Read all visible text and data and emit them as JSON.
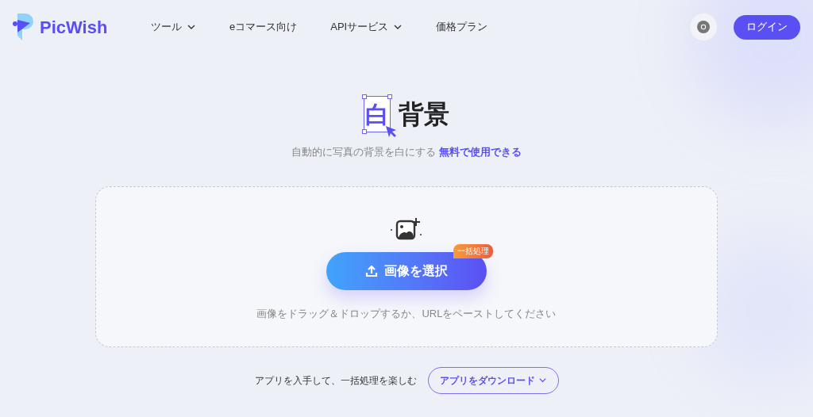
{
  "header": {
    "logo": "PicWish",
    "nav": [
      {
        "label": "ツール",
        "dropdown": true
      },
      {
        "label": "eコマース向け",
        "dropdown": false
      },
      {
        "label": "APIサービス",
        "dropdown": true
      },
      {
        "label": "価格プラン",
        "dropdown": false
      }
    ],
    "login": "ログイン"
  },
  "hero": {
    "title_highlight": "白",
    "title_rest": "背景",
    "subtitle": "自動的に写真の背景を白にする",
    "subtitle_link": "無料で使用できる"
  },
  "upload": {
    "button": "画像を選択",
    "badge": "一括処理",
    "hint": "画像をドラッグ＆ドロップするか、URLをペーストしてください"
  },
  "app_promo": {
    "text": "アプリを入手して、一括処理を楽しむ",
    "button": "アプリをダウンロード"
  }
}
